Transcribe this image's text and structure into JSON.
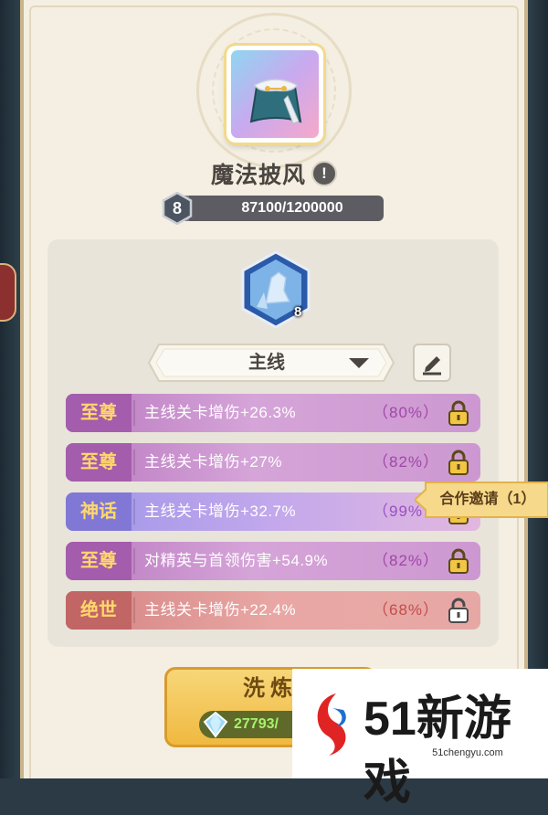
{
  "equipment": {
    "name": "魔法披风",
    "level": "8",
    "exp_text": "87100/1200000",
    "exp_fraction": 0.0726
  },
  "skill": {
    "level": "8"
  },
  "dropdown": {
    "selected": "主线"
  },
  "affixes": [
    {
      "tier": "至尊",
      "desc": "主线关卡增伤+26.3%",
      "pct": "（80%）",
      "locked": true
    },
    {
      "tier": "至尊",
      "desc": "主线关卡增伤+27%",
      "pct": "（82%）",
      "locked": true
    },
    {
      "tier": "神话",
      "desc": "主线关卡增伤+32.7%",
      "pct": "（99%",
      "locked": true
    },
    {
      "tier": "至尊",
      "desc": "对精英与首领伤害+54.9%",
      "pct": "（82%）",
      "locked": true
    },
    {
      "tier": "绝世",
      "desc": "主线关卡增伤+22.4%",
      "pct": "（68%）",
      "locked": false
    }
  ],
  "coop_invite": "合作邀请（1）",
  "wash": {
    "label": "洗炼",
    "cost": "27793/"
  },
  "watermark": {
    "num": "51",
    "name": "新游戏",
    "url": "51chengyu.com"
  },
  "colors": {
    "panel": "#f4efe2",
    "supreme": "#a45cac",
    "myth": "#8178d6",
    "peerless": "#c26565",
    "tier_text": "#ffd86b"
  },
  "icons": [
    "info-icon",
    "edit-icon",
    "lock-icon",
    "unlock-icon",
    "gem-icon",
    "chevron-down-icon"
  ]
}
